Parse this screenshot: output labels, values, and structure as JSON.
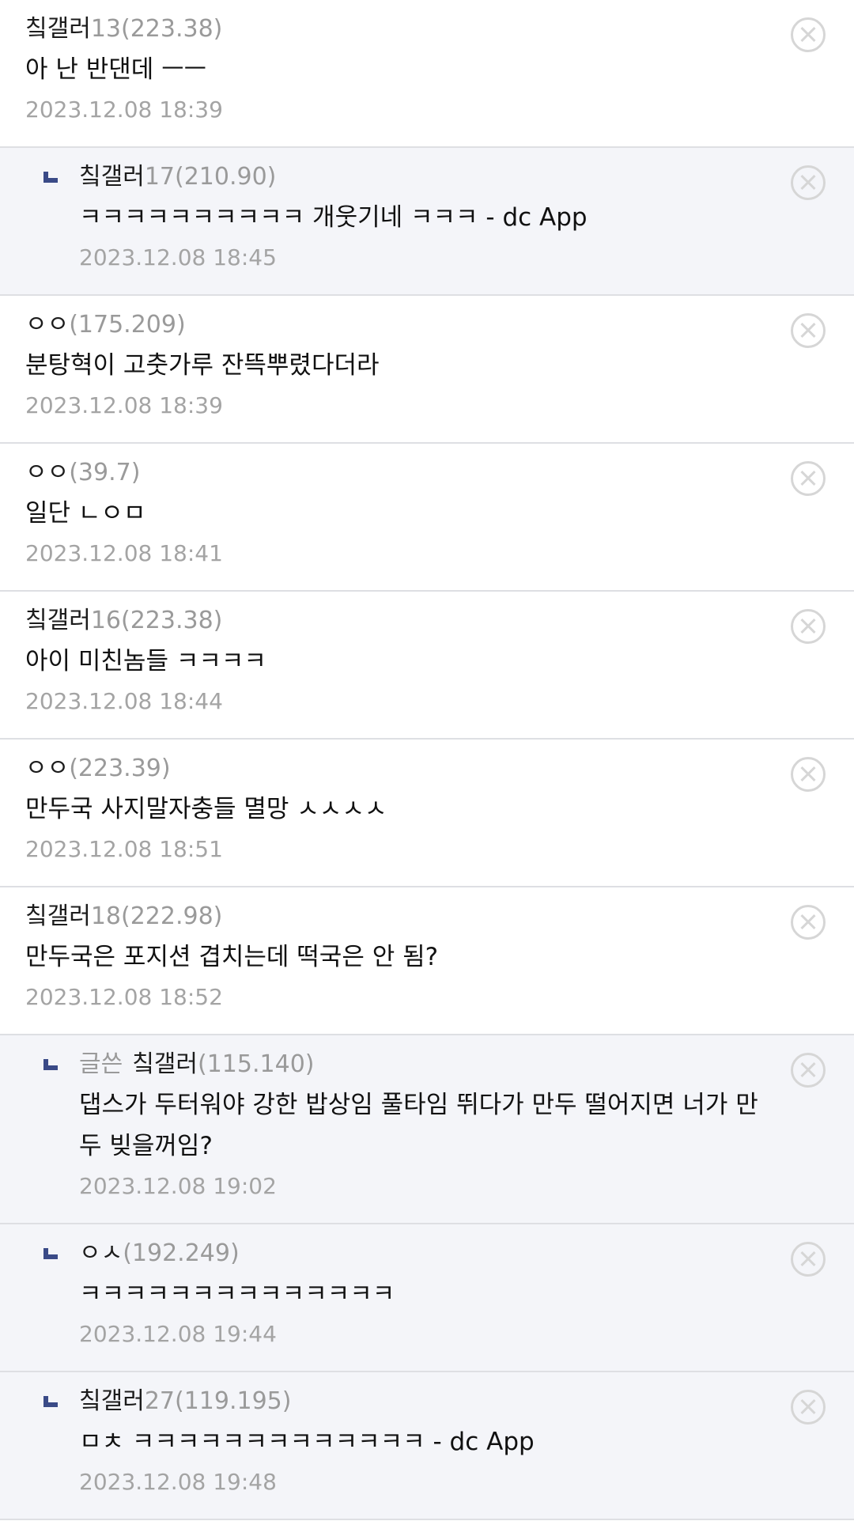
{
  "comments": [
    {
      "writer_tag": "",
      "nick": "칰갤러",
      "ip": "13(223.38)",
      "text": "아 난 반댄데 ㅡㅡ",
      "date": "2023.12.08 18:39",
      "reply": false
    },
    {
      "writer_tag": "",
      "nick": "칰갤러",
      "ip": "17(210.90)",
      "text": "ㅋㅋㅋㅋㅋㅋㅋㅋㅋㅋ 개웃기네 ㅋㅋㅋ - dc App",
      "date": "2023.12.08 18:45",
      "reply": true
    },
    {
      "writer_tag": "",
      "nick": "ㅇㅇ",
      "ip": "(175.209)",
      "text": "분탕혁이 고춧가루 잔뜩뿌렸다더라",
      "date": "2023.12.08 18:39",
      "reply": false
    },
    {
      "writer_tag": "",
      "nick": "ㅇㅇ",
      "ip": "(39.7)",
      "text": "일단 ㄴㅇㅁ",
      "date": "2023.12.08 18:41",
      "reply": false
    },
    {
      "writer_tag": "",
      "nick": "칰갤러",
      "ip": "16(223.38)",
      "text": "아이 미친놈들 ㅋㅋㅋㅋ",
      "date": "2023.12.08 18:44",
      "reply": false
    },
    {
      "writer_tag": "",
      "nick": "ㅇㅇ",
      "ip": "(223.39)",
      "text": "만두국 사지말자충들 멸망 ㅅㅅㅅㅅ",
      "date": "2023.12.08 18:51",
      "reply": false
    },
    {
      "writer_tag": "",
      "nick": "칰갤러",
      "ip": "18(222.98)",
      "text": "만두국은 포지션 겹치는데 떡국은 안 됨?",
      "date": "2023.12.08 18:52",
      "reply": false
    },
    {
      "writer_tag": "글쓴",
      "nick": "칰갤러",
      "ip": "(115.140)",
      "text": "댑스가 두터워야 강한 밥상임 풀타임 뛰다가 만두 떨어지면 너가 만두 빚을꺼임?",
      "date": "2023.12.08 19:02",
      "reply": true
    },
    {
      "writer_tag": "",
      "nick": "ㅇㅅ",
      "ip": "(192.249)",
      "text": "ㅋㅋㅋㅋㅋㅋㅋㅋㅋㅋㅋㅋㅋㅋ",
      "date": "2023.12.08 19:44",
      "reply": true
    },
    {
      "writer_tag": "",
      "nick": "칰갤러",
      "ip": "27(119.195)",
      "text": "ㅁㅊ ㅋㅋㅋㅋㅋㅋㅋㅋㅋㅋㅋㅋㅋ - dc App",
      "date": "2023.12.08 19:48",
      "reply": true
    }
  ]
}
